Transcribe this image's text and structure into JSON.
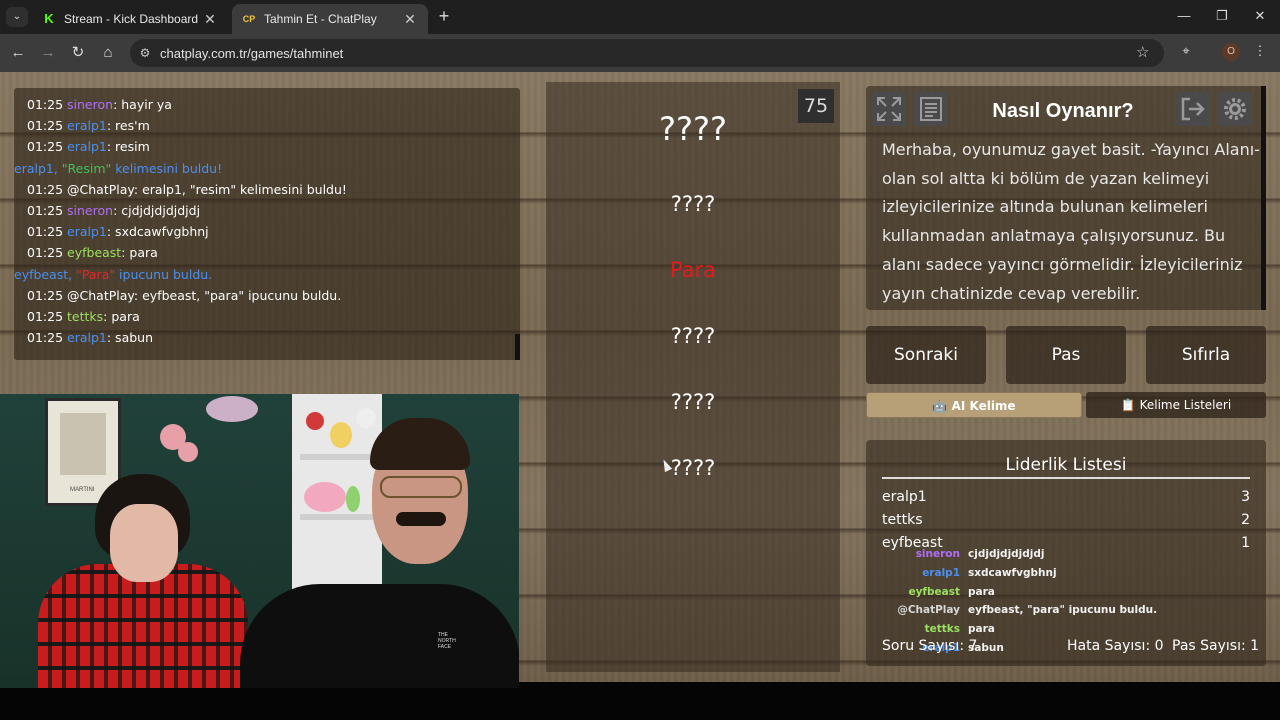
{
  "browser": {
    "tabs": [
      {
        "title": "Stream - Kick Dashboard",
        "favicon": "K",
        "active": false
      },
      {
        "title": "Tahmin Et - ChatPlay",
        "favicon": "CP",
        "active": true
      }
    ],
    "url": "chatplay.com.tr/games/tahminet",
    "profile_initial": "O"
  },
  "chat": {
    "lines": [
      {
        "time": "01:25",
        "user": "sineron",
        "color": "purple",
        "msg": ": hayir ya"
      },
      {
        "time": "01:25",
        "user": "eralp1",
        "color": "blue",
        "msg": ": res'm"
      },
      {
        "time": "01:25",
        "user": "eralp1",
        "color": "blue",
        "msg": ": resim"
      },
      {
        "system": true,
        "pre": "eralp1, ",
        "quote": "\"Resim\"",
        "quote_color": "green",
        "post": " kelimesini buldu!"
      },
      {
        "time": "01:25",
        "user": "@ChatPlay",
        "color": "white",
        "msg": ": eralp1, \"resim\" kelimesini buldu!"
      },
      {
        "time": "01:25",
        "user": "sineron",
        "color": "purple",
        "msg": ": cjdjdjdjdjdjdj"
      },
      {
        "time": "01:25",
        "user": "eralp1",
        "color": "blue",
        "msg": ": sxdcawfvgbhnj"
      },
      {
        "time": "01:25",
        "user": "eyfbeast",
        "color": "green",
        "msg": ": para"
      },
      {
        "system": true,
        "pre": "eyfbeast, ",
        "quote": "\"Para\"",
        "quote_color": "red",
        "post": " ipucunu buldu."
      },
      {
        "time": "01:25",
        "user": "@ChatPlay",
        "color": "white",
        "msg": ": eyfbeast, \"para\" ipucunu buldu."
      },
      {
        "time": "01:25",
        "user": "tettks",
        "color": "green",
        "msg": ": para"
      },
      {
        "time": "01:25",
        "user": "eralp1",
        "color": "blue",
        "msg": ": sabun"
      }
    ]
  },
  "webcam": {
    "poster_label": "MARTINI"
  },
  "game": {
    "timer": "75",
    "words": [
      {
        "text": "????",
        "style": "big"
      },
      {
        "text": "????",
        "style": "norm"
      },
      {
        "text": "Para",
        "style": "red"
      },
      {
        "text": "????",
        "style": "norm"
      },
      {
        "text": "????",
        "style": "norm"
      },
      {
        "text": "????",
        "style": "norm"
      }
    ]
  },
  "how_to_play": {
    "title": "Nasıl Oynanır?",
    "text": "Merhaba, oyunumuz gayet basit. -Yayıncı Alanı- olan sol altta ki bölüm de yazan kelimeyi izleyicilerinize altında bulunan kelimeleri kullanmadan anlatmaya çalışıyorsunuz. Bu alanı sadece yayıncı görmelidir. İzleyicileriniz yayın chatinizde cevap verebilir."
  },
  "controls": {
    "next": "Sonraki",
    "pass": "Pas",
    "reset": "Sıfırla",
    "ai_word": "AI Kelime",
    "word_lists": "Kelime Listeleri"
  },
  "leaderboard": {
    "title": "Liderlik Listesi",
    "rows": [
      {
        "name": "eralp1",
        "score": "3"
      },
      {
        "name": "tettks",
        "score": "2"
      },
      {
        "name": "eyfbeast",
        "score": "1"
      }
    ],
    "overlay": [
      {
        "user": "sineron",
        "color": "#b06ef7",
        "msg": "cjdjdjdjdjdjdj"
      },
      {
        "user": "eralp1",
        "color": "#4b8ff0",
        "msg": "sxdcawfvgbhnj"
      },
      {
        "user": "eyfbeast",
        "color": "#9be060",
        "msg": "para"
      },
      {
        "user": "@ChatPlay",
        "color": "#d8d8d8",
        "msg": "eyfbeast, \"para\" ipucunu buldu."
      },
      {
        "user": "tettks",
        "color": "#9be060",
        "msg": "para"
      },
      {
        "user": "eralp1",
        "color": "#4b8ff0",
        "msg": "sabun"
      }
    ],
    "stats": {
      "questions": "Soru Sayısı: 7",
      "errors": "Hata Sayısı: 0",
      "passes": "Pas Sayısı: 1"
    }
  }
}
